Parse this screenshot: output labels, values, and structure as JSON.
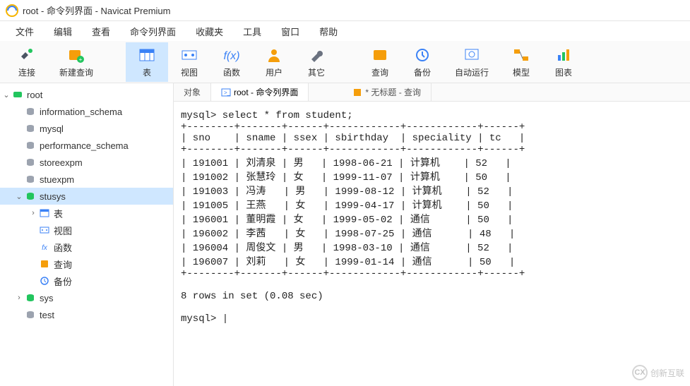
{
  "window": {
    "title": "root - 命令列界面 - Navicat Premium"
  },
  "menubar": [
    "文件",
    "编辑",
    "查看",
    "命令列界面",
    "收藏夹",
    "工具",
    "窗口",
    "帮助"
  ],
  "toolbar": [
    "连接",
    "新建查询",
    "表",
    "视图",
    "函数",
    "用户",
    "其它",
    "查询",
    "备份",
    "自动运行",
    "模型",
    "图表"
  ],
  "sidebar": {
    "root": "root",
    "dbs": [
      "information_schema",
      "mysql",
      "performance_schema",
      "storeexpm",
      "stuexpm",
      "stusys",
      "sys",
      "test"
    ],
    "stusys_children": [
      "表",
      "视图",
      "函数",
      "查询",
      "备份"
    ]
  },
  "tabs": {
    "t1": "对象",
    "t2": "root - 命令列界面",
    "t3": "* 无标题 - 查询"
  },
  "terminal": {
    "prompt1": "mysql> select * from student;",
    "sep": "+--------+-------+------+------------+------------+------+",
    "header": "| sno    | sname | ssex | sbirthday  | speciality | tc   |",
    "rows": [
      "| 191001 | 刘清泉 | 男   | 1998-06-21 | 计算机    | 52   |",
      "| 191002 | 张慧玲 | 女   | 1999-11-07 | 计算机    | 50   |",
      "| 191003 | 冯涛   | 男   | 1999-08-12 | 计算机    | 52   |",
      "| 191005 | 王燕   | 女   | 1999-04-17 | 计算机    | 50   |",
      "| 196001 | 董明霞 | 女   | 1999-05-02 | 通信      | 50   |",
      "| 196002 | 李茜   | 女   | 1998-07-25 | 通信      | 48   |",
      "| 196004 | 周俊文 | 男   | 1998-03-10 | 通信      | 52   |",
      "| 196007 | 刘莉   | 女   | 1999-01-14 | 通信      | 50   |"
    ],
    "summary": "8 rows in set (0.08 sec)",
    "prompt2": "mysql> "
  },
  "watermark": {
    "brand": "创新互联"
  },
  "chart_data": {
    "type": "table",
    "title": "student",
    "query": "select * from student;",
    "columns": [
      "sno",
      "sname",
      "ssex",
      "sbirthday",
      "speciality",
      "tc"
    ],
    "rows": [
      {
        "sno": "191001",
        "sname": "刘清泉",
        "ssex": "男",
        "sbirthday": "1998-06-21",
        "speciality": "计算机",
        "tc": 52
      },
      {
        "sno": "191002",
        "sname": "张慧玲",
        "ssex": "女",
        "sbirthday": "1999-11-07",
        "speciality": "计算机",
        "tc": 50
      },
      {
        "sno": "191003",
        "sname": "冯涛",
        "ssex": "男",
        "sbirthday": "1999-08-12",
        "speciality": "计算机",
        "tc": 52
      },
      {
        "sno": "191005",
        "sname": "王燕",
        "ssex": "女",
        "sbirthday": "1999-04-17",
        "speciality": "计算机",
        "tc": 50
      },
      {
        "sno": "196001",
        "sname": "董明霞",
        "ssex": "女",
        "sbirthday": "1999-05-02",
        "speciality": "通信",
        "tc": 50
      },
      {
        "sno": "196002",
        "sname": "李茜",
        "ssex": "女",
        "sbirthday": "1998-07-25",
        "speciality": "通信",
        "tc": 48
      },
      {
        "sno": "196004",
        "sname": "周俊文",
        "ssex": "男",
        "sbirthday": "1998-03-10",
        "speciality": "通信",
        "tc": 52
      },
      {
        "sno": "196007",
        "sname": "刘莉",
        "ssex": "女",
        "sbirthday": "1999-01-14",
        "speciality": "通信",
        "tc": 50
      }
    ],
    "row_count": 8,
    "elapsed_sec": 0.08
  }
}
